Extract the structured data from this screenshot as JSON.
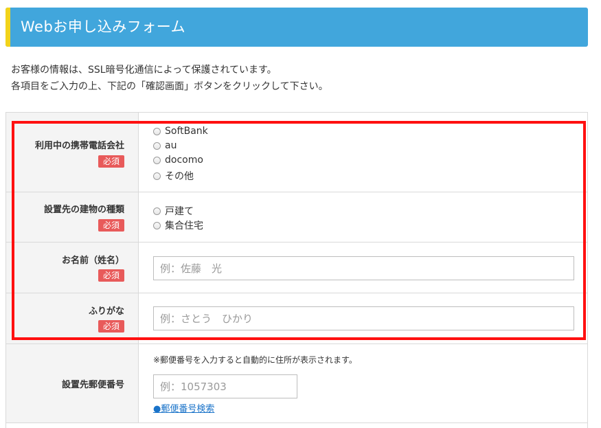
{
  "header": {
    "title": "Webお申し込みフォーム"
  },
  "intro": {
    "line1": "お客様の情報は、SSL暗号化通信によって保護されています。",
    "line2": "各項目をご入力の上、下記の「確認画面」ボタンをクリックして下さい。"
  },
  "rows": {
    "carrier": {
      "label": "利用中の携帯電話会社",
      "required": "必須",
      "options": [
        "SoftBank",
        "au",
        "docomo",
        "その他"
      ]
    },
    "building": {
      "label": "設置先の建物の種類",
      "required": "必須",
      "options": [
        "戸建て",
        "集合住宅"
      ]
    },
    "name": {
      "label": "お名前（姓名）",
      "required": "必須",
      "placeholder": "例：佐藤　光",
      "value": ""
    },
    "kana": {
      "label": "ふりがな",
      "required": "必須",
      "placeholder": "例：さとう　ひかり",
      "value": ""
    },
    "postal": {
      "label": "設置先郵便番号",
      "note": "※郵便番号を入力すると自動的に住所が表示されます。",
      "placeholder": "例：1057303",
      "value": "",
      "search_link": "●郵便番号検索"
    }
  },
  "colors": {
    "header_bg": "#41a6dc",
    "header_accent": "#f2d31b",
    "required_badge": "#e85a5a",
    "highlight_border": "#ff1010",
    "link": "#1a73c9"
  }
}
